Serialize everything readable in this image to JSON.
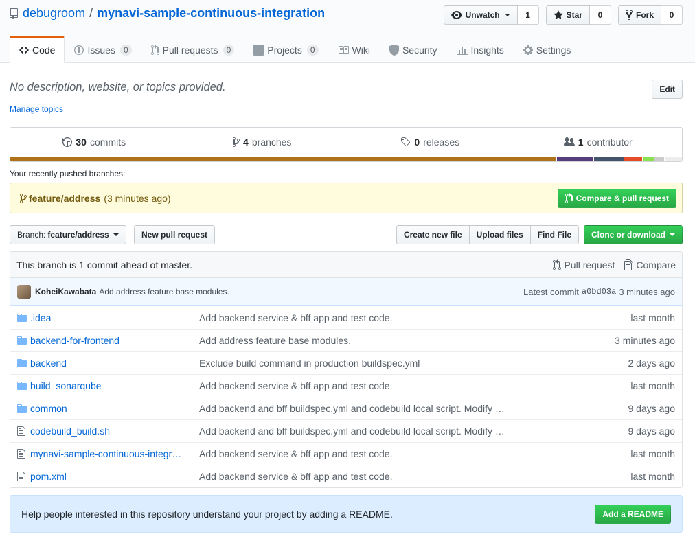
{
  "repo": {
    "owner": "debugroom",
    "separator": "/",
    "name": "mynavi-sample-continuous-integration"
  },
  "actions": {
    "watch": {
      "label": "Unwatch",
      "count": "1"
    },
    "star": {
      "label": "Star",
      "count": "0"
    },
    "fork": {
      "label": "Fork",
      "count": "0"
    }
  },
  "nav": {
    "tabs": [
      {
        "label": "Code",
        "icon": "code-icon"
      },
      {
        "label": "Issues",
        "icon": "issue-icon",
        "counter": "0"
      },
      {
        "label": "Pull requests",
        "icon": "pull-request-icon",
        "counter": "0"
      },
      {
        "label": "Projects",
        "icon": "project-icon",
        "counter": "0"
      },
      {
        "label": "Wiki",
        "icon": "book-icon"
      },
      {
        "label": "Security",
        "icon": "shield-icon"
      },
      {
        "label": "Insights",
        "icon": "graph-icon"
      },
      {
        "label": "Settings",
        "icon": "gear-icon"
      }
    ]
  },
  "description": {
    "text": "No description, website, or topics provided.",
    "edit_label": "Edit",
    "manage_topics": "Manage topics"
  },
  "summary": {
    "commits": {
      "count": "30",
      "label": "commits"
    },
    "branches": {
      "count": "4",
      "label": "branches"
    },
    "releases": {
      "count": "0",
      "label": "releases"
    },
    "contributors": {
      "count": "1",
      "label": "contributor"
    },
    "languages": [
      {
        "color": "#b07219",
        "fraction": 0.818
      },
      {
        "color": "#563d7c",
        "fraction": 0.054
      },
      {
        "color": "#44546a",
        "fraction": 0.045
      },
      {
        "color": "#e34c26",
        "fraction": 0.026
      },
      {
        "color": "#89e051",
        "fraction": 0.017
      },
      {
        "color": "#cccccc",
        "fraction": 0.014
      },
      {
        "color": "#ededed",
        "fraction": 0.026
      }
    ]
  },
  "recent": {
    "heading": "Your recently pushed branches:",
    "branch": "feature/address",
    "when": "(3 minutes ago)",
    "compare_label": "Compare & pull request"
  },
  "file_nav": {
    "branch_prefix": "Branch:",
    "branch": "feature/address",
    "new_pr": "New pull request",
    "create_file": "Create new file",
    "upload": "Upload files",
    "find": "Find File",
    "clone": "Clone or download"
  },
  "branch_info": {
    "text": "This branch is 1 commit ahead of master.",
    "pull_request": "Pull request",
    "compare": "Compare"
  },
  "latest_commit": {
    "author": "KoheiKawabata",
    "message": "Add address feature base modules.",
    "label": "Latest commit",
    "sha": "a0bd03a",
    "age": "3 minutes ago"
  },
  "files": [
    {
      "type": "dir",
      "name": ".idea",
      "message": "Add backend service & bff app and test code.",
      "age": "last month"
    },
    {
      "type": "dir",
      "name": "backend-for-frontend",
      "message": "Add address feature base modules.",
      "age": "3 minutes ago"
    },
    {
      "type": "dir",
      "name": "backend",
      "message": "Exclude build command in production buildspec.yml",
      "age": "2 days ago"
    },
    {
      "type": "dir",
      "name": "build_sonarqube",
      "message": "Add backend service & bff app and test code.",
      "age": "last month"
    },
    {
      "type": "dir",
      "name": "common",
      "message": "Add backend and bff buildspec.yml and codebuild local script. Modify …",
      "age": "9 days ago"
    },
    {
      "type": "file",
      "name": "codebuild_build.sh",
      "message": "Add backend and bff buildspec.yml and codebuild local script. Modify …",
      "age": "9 days ago"
    },
    {
      "type": "file",
      "name": "mynavi-sample-continuous-integr…",
      "message": "Add backend service & bff app and test code.",
      "age": "last month"
    },
    {
      "type": "file",
      "name": "pom.xml",
      "message": "Add backend service & bff app and test code.",
      "age": "last month"
    }
  ],
  "readme": {
    "text": "Help people interested in this repository understand your project by adding a README.",
    "button": "Add a README"
  }
}
